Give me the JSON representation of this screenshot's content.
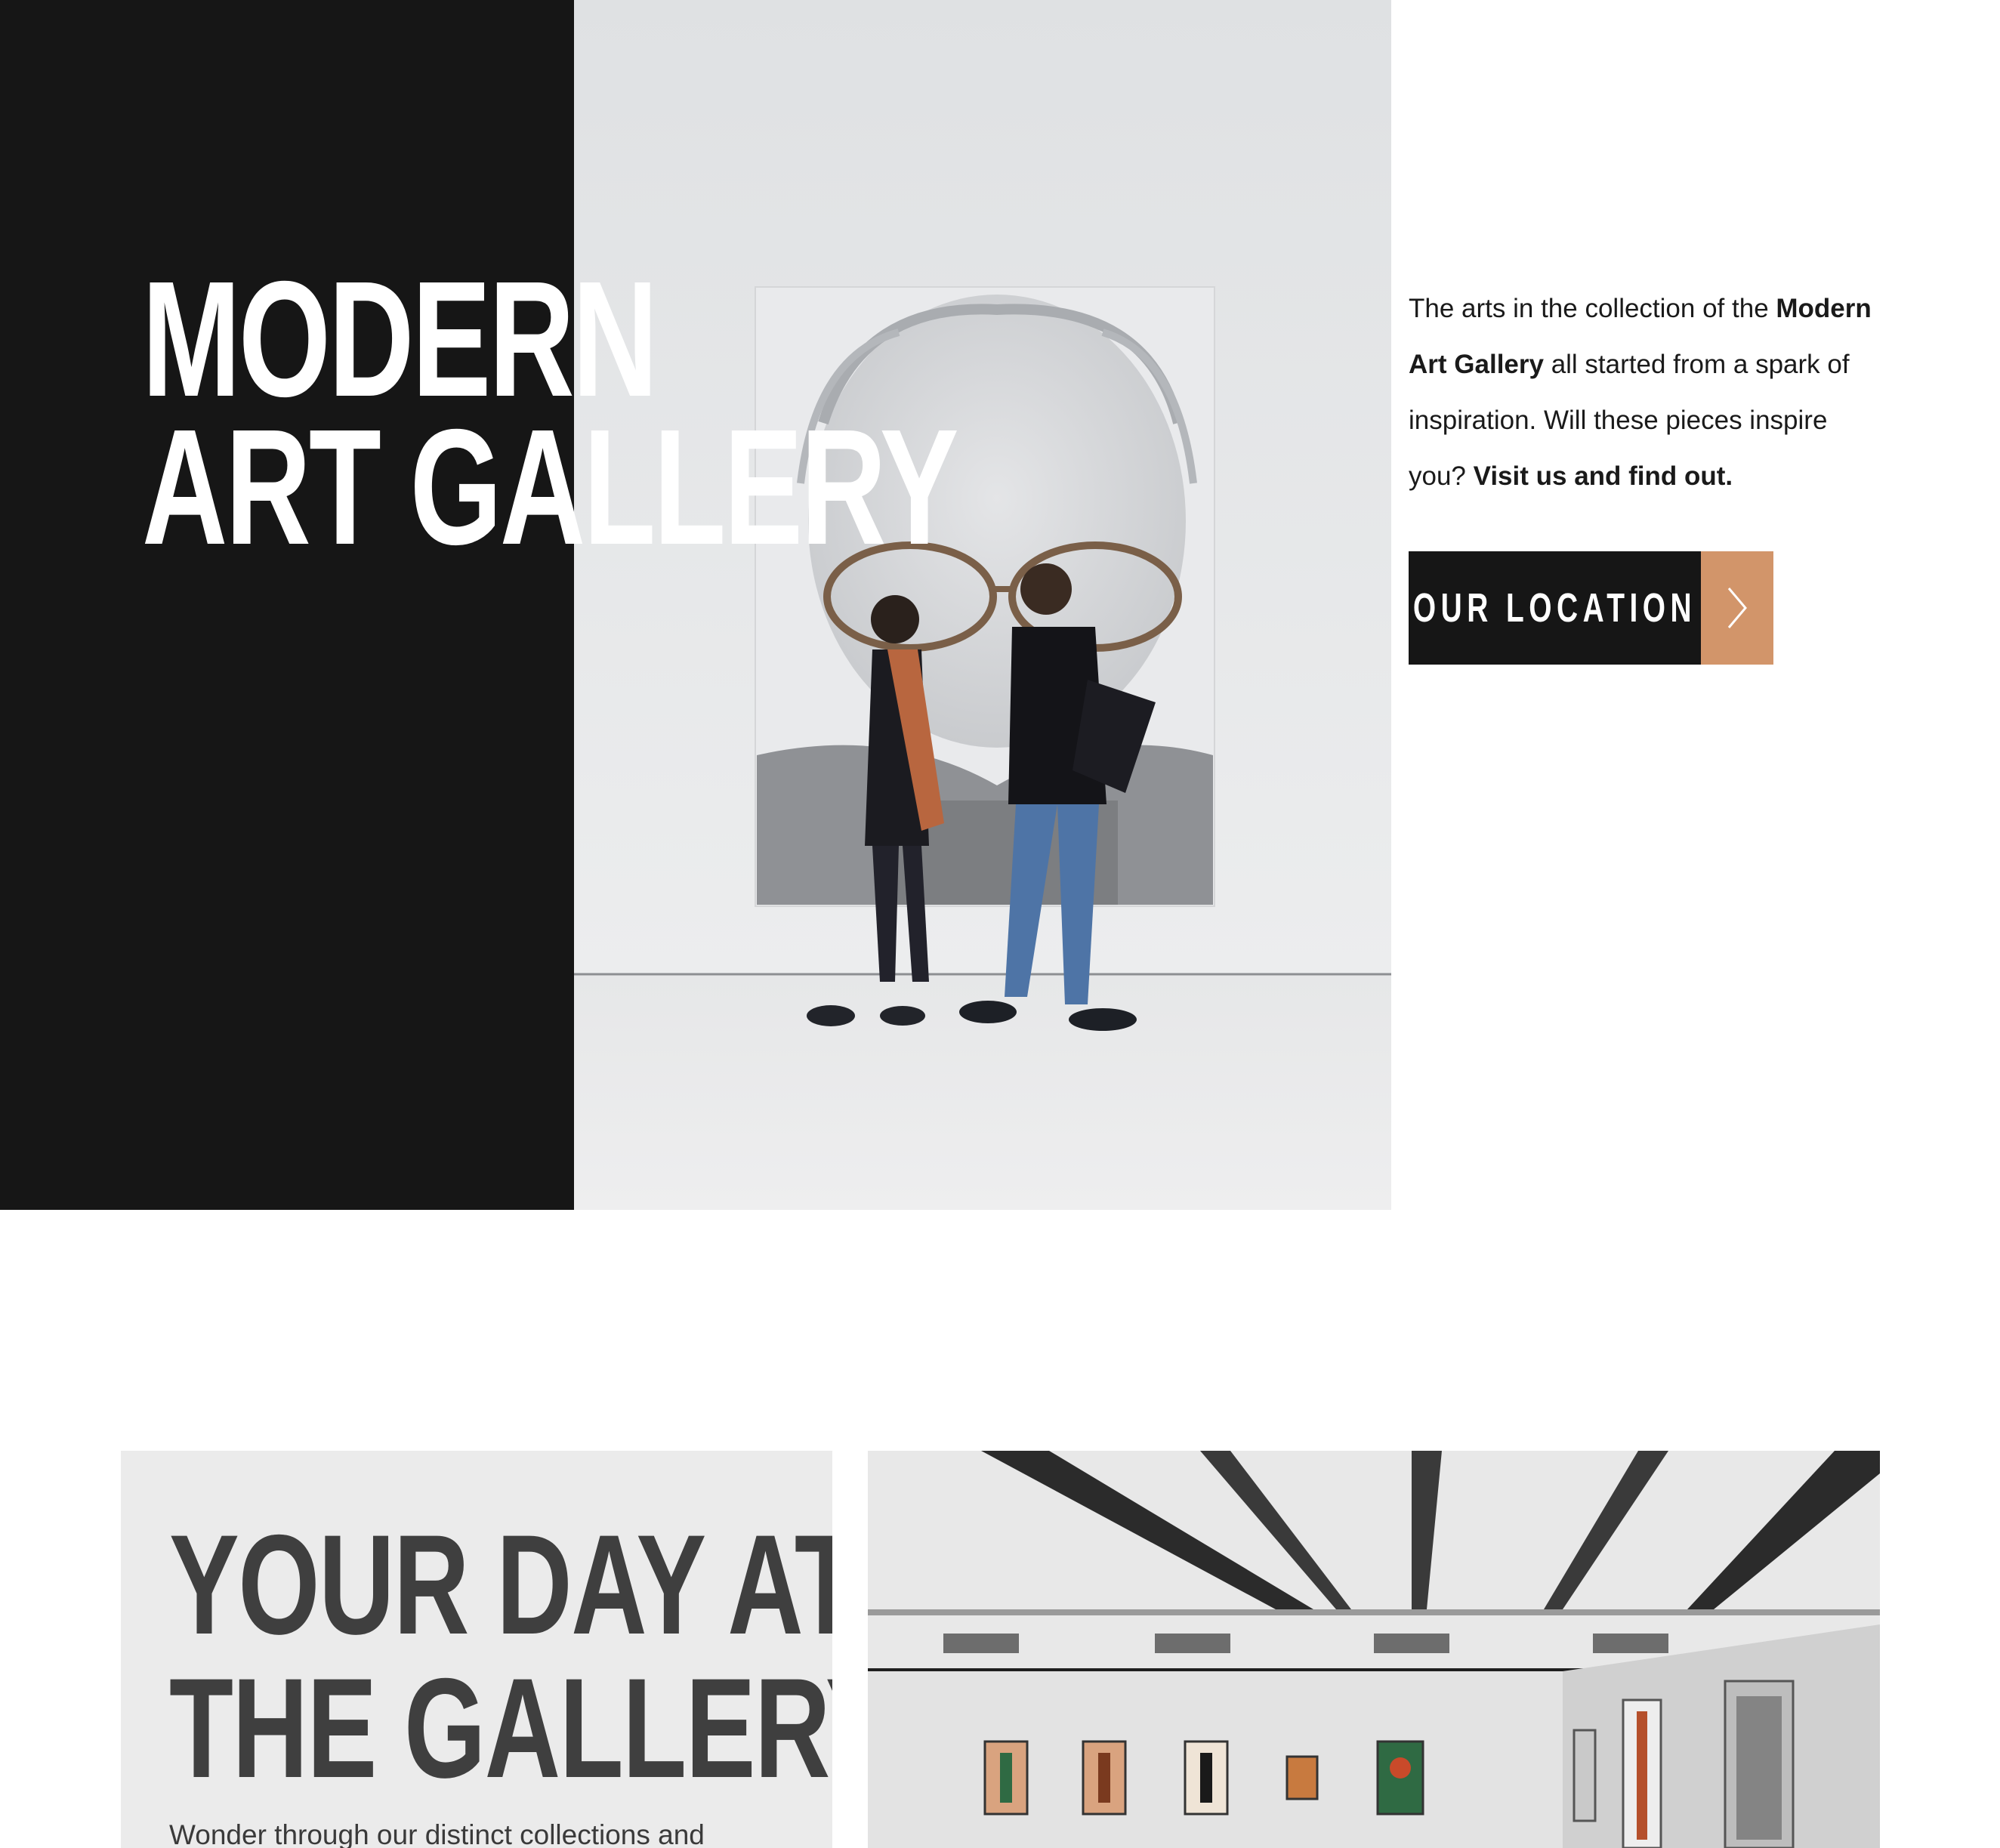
{
  "hero": {
    "title_line1": "MODERN",
    "title_line2": "ART GALLERY",
    "intro": {
      "part1": "The arts in the collection of the ",
      "bold1": "Modern Art Gallery",
      "part2": " all started from a spark of inspiration. Will these pieces inspire you? ",
      "bold2": "Visit us and find out."
    },
    "location_button": "OUR LOCATION",
    "location_icon": "chevron-right-icon"
  },
  "day_section": {
    "title_line1": "YOUR DAY AT",
    "title_line2": "THE GALLERY",
    "text": "Wonder through our distinct collections and"
  },
  "colors": {
    "dark": "#161616",
    "accent": "#d2956a",
    "panel": "#ebebeb",
    "heading_gray": "#3f3f3f"
  }
}
